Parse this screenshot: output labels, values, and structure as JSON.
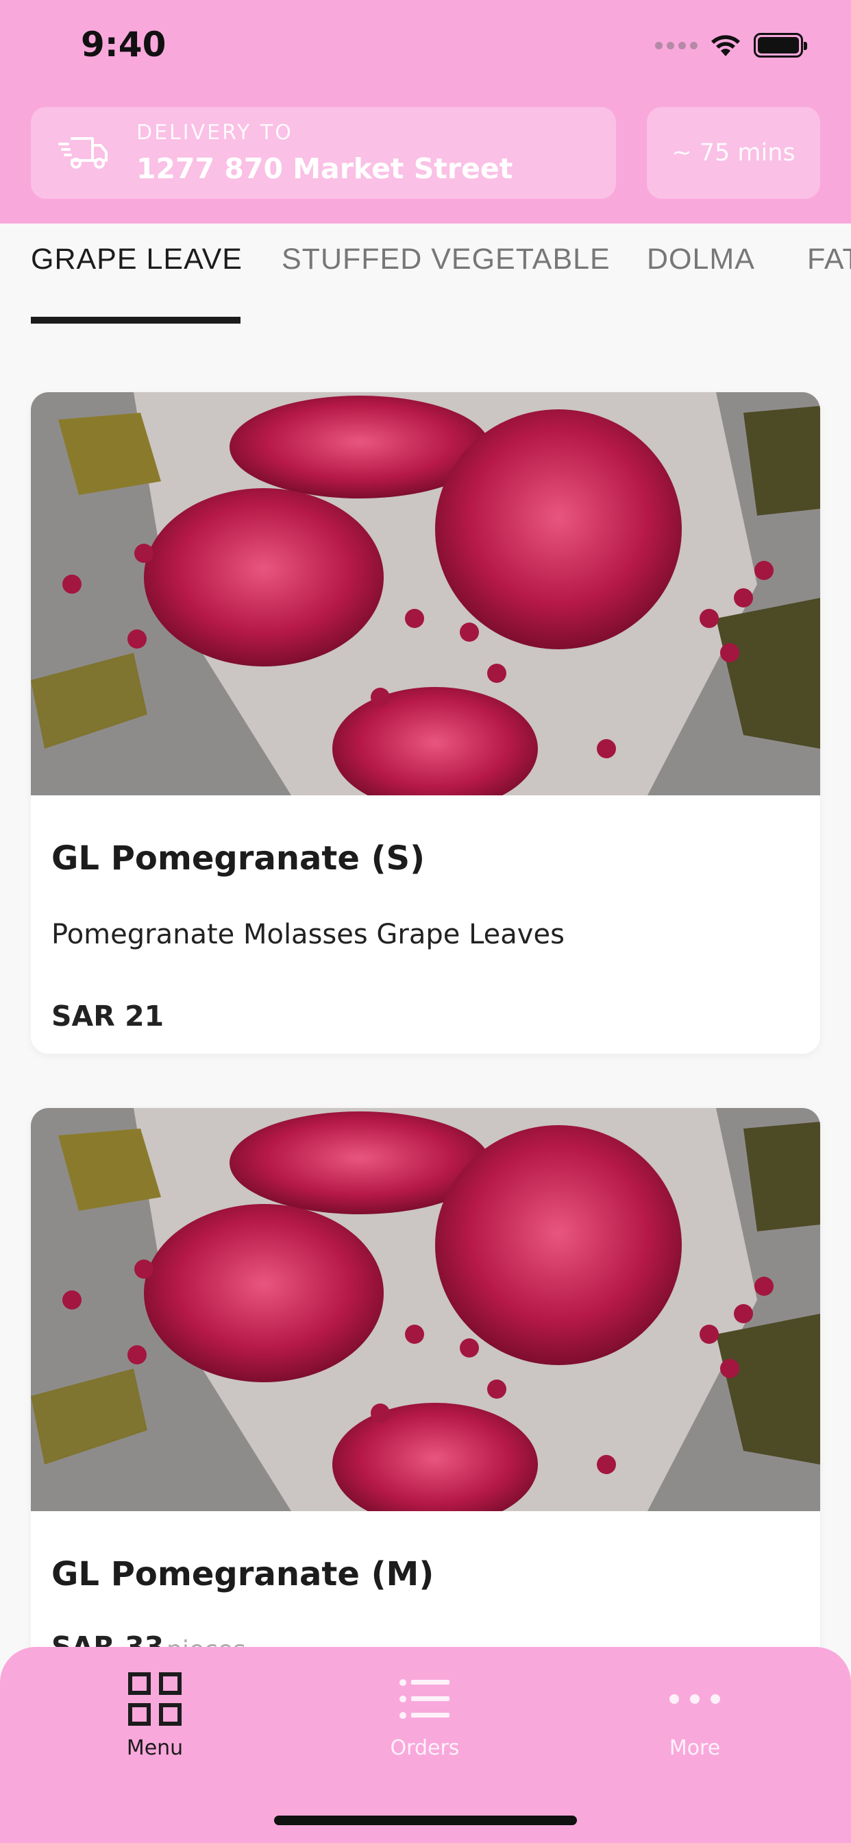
{
  "status_bar": {
    "time": "9:40"
  },
  "delivery": {
    "label": "DELIVERY TO",
    "address": "1277 870 Market Street"
  },
  "eta": "~ 75 mins",
  "tabs": [
    {
      "label": "GRAPE LEAVE",
      "active": true
    },
    {
      "label": "STUFFED VEGETABLE",
      "active": false
    },
    {
      "label": "DOLMA",
      "active": false
    },
    {
      "label": "FATTEH",
      "active": false
    }
  ],
  "items": [
    {
      "title": "GL Pomegranate (S)",
      "description": "Pomegranate Molasses Grape Leaves",
      "price": "SAR 21",
      "image_icon": "pomegranate-food-photo"
    },
    {
      "title": "GL Pomegranate (M)",
      "price": "SAR 33",
      "pieces": "pieces",
      "image_icon": "pomegranate-food-photo"
    }
  ],
  "bottom_nav": {
    "menu": "Menu",
    "orders": "Orders",
    "more": "More"
  },
  "colors": {
    "accent": "#f9a8dc",
    "text": "#1c1c1c",
    "inactive_tab": "#777777"
  }
}
